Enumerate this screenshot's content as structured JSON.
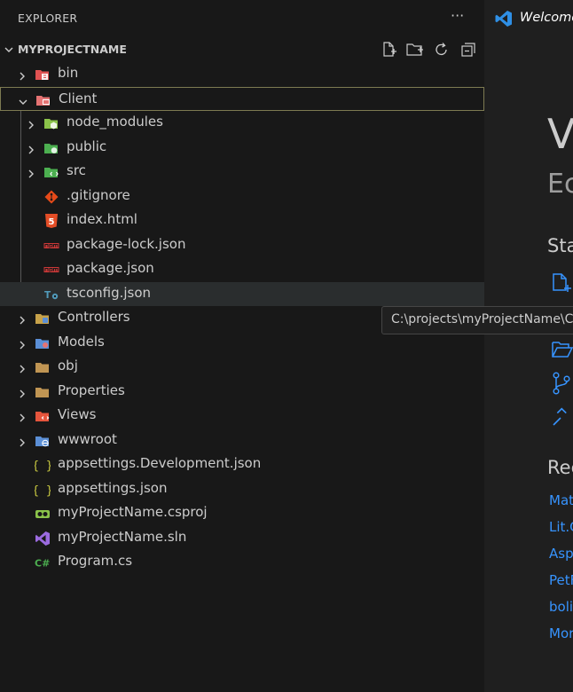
{
  "explorer": {
    "title": "EXPLORER",
    "more_label": "···",
    "section_title": "MYPROJECTNAME",
    "tree": [
      {
        "label": "bin",
        "kind": "folder",
        "depth": 0,
        "expanded": false,
        "icon": "bin-folder-icon",
        "color": "#e05252"
      },
      {
        "label": "Client",
        "kind": "folder",
        "depth": 0,
        "expanded": true,
        "icon": "client-folder-icon",
        "color": "#e57373",
        "focused": true
      },
      {
        "label": "node_modules",
        "kind": "folder",
        "depth": 1,
        "expanded": false,
        "icon": "node-modules-folder-icon",
        "color": "#8bc34a"
      },
      {
        "label": "public",
        "kind": "folder",
        "depth": 1,
        "expanded": false,
        "icon": "public-folder-icon",
        "color": "#4caf50"
      },
      {
        "label": "src",
        "kind": "folder",
        "depth": 1,
        "expanded": false,
        "icon": "src-folder-icon",
        "color": "#4caf50"
      },
      {
        "label": ".gitignore",
        "kind": "file",
        "depth": 1,
        "icon": "git-icon",
        "color": "#e64a19"
      },
      {
        "label": "index.html",
        "kind": "file",
        "depth": 1,
        "icon": "html5-icon",
        "color": "#e44d26"
      },
      {
        "label": "package-lock.json",
        "kind": "file",
        "depth": 1,
        "icon": "npm-icon",
        "color": "#cb3837"
      },
      {
        "label": "package.json",
        "kind": "file",
        "depth": 1,
        "icon": "npm-icon",
        "color": "#cb3837"
      },
      {
        "label": "tsconfig.json",
        "kind": "file",
        "depth": 1,
        "icon": "tsconfig-icon",
        "color": "#519aba",
        "hovered": true
      },
      {
        "label": "Controllers",
        "kind": "folder",
        "depth": 0,
        "expanded": false,
        "icon": "controllers-folder-icon",
        "color": "#c7a24a"
      },
      {
        "label": "Models",
        "kind": "folder",
        "depth": 0,
        "expanded": false,
        "icon": "models-folder-icon",
        "color": "#5b8fd6"
      },
      {
        "label": "obj",
        "kind": "folder",
        "depth": 0,
        "expanded": false,
        "icon": "folder-icon",
        "color": "#c09553"
      },
      {
        "label": "Properties",
        "kind": "folder",
        "depth": 0,
        "expanded": false,
        "icon": "folder-icon",
        "color": "#c09553"
      },
      {
        "label": "Views",
        "kind": "folder",
        "depth": 0,
        "expanded": false,
        "icon": "views-folder-icon",
        "color": "#e5553d"
      },
      {
        "label": "wwwroot",
        "kind": "folder",
        "depth": 0,
        "expanded": false,
        "icon": "wwwroot-folder-icon",
        "color": "#5b8fd6"
      },
      {
        "label": "appsettings.Development.json",
        "kind": "file",
        "depth": 0,
        "icon": "json-braces-icon",
        "color": "#cbcb41"
      },
      {
        "label": "appsettings.json",
        "kind": "file",
        "depth": 0,
        "icon": "json-braces-icon",
        "color": "#cbcb41"
      },
      {
        "label": "myProjectName.csproj",
        "kind": "file",
        "depth": 0,
        "icon": "csproj-icon",
        "color": "#8bc34a"
      },
      {
        "label": "myProjectName.sln",
        "kind": "file",
        "depth": 0,
        "icon": "visual-studio-icon",
        "color": "#9b6bdf"
      },
      {
        "label": "Program.cs",
        "kind": "file",
        "depth": 0,
        "icon": "csharp-icon",
        "color": "#4caf50"
      }
    ]
  },
  "tooltip": {
    "text": "C:\\projects\\myProjectName\\Cli"
  },
  "editor": {
    "tab_label": "Welcome",
    "heading_partial": "V",
    "subheading_partial": "Ec",
    "start_heading_partial": "Sta",
    "recent_heading_partial": "Rec",
    "recent_links": [
      "Mat",
      "Lit.C",
      "Asp",
      "PetF",
      "boli",
      "Mor"
    ]
  },
  "colors": {
    "sidebar_bg": "#181818",
    "editor_bg": "#1f1f1f",
    "hover_row": "#2a2d2e",
    "focus_border": "#7d7a52",
    "link": "#3794ff",
    "vscode_blue": "#2f8fe5"
  }
}
